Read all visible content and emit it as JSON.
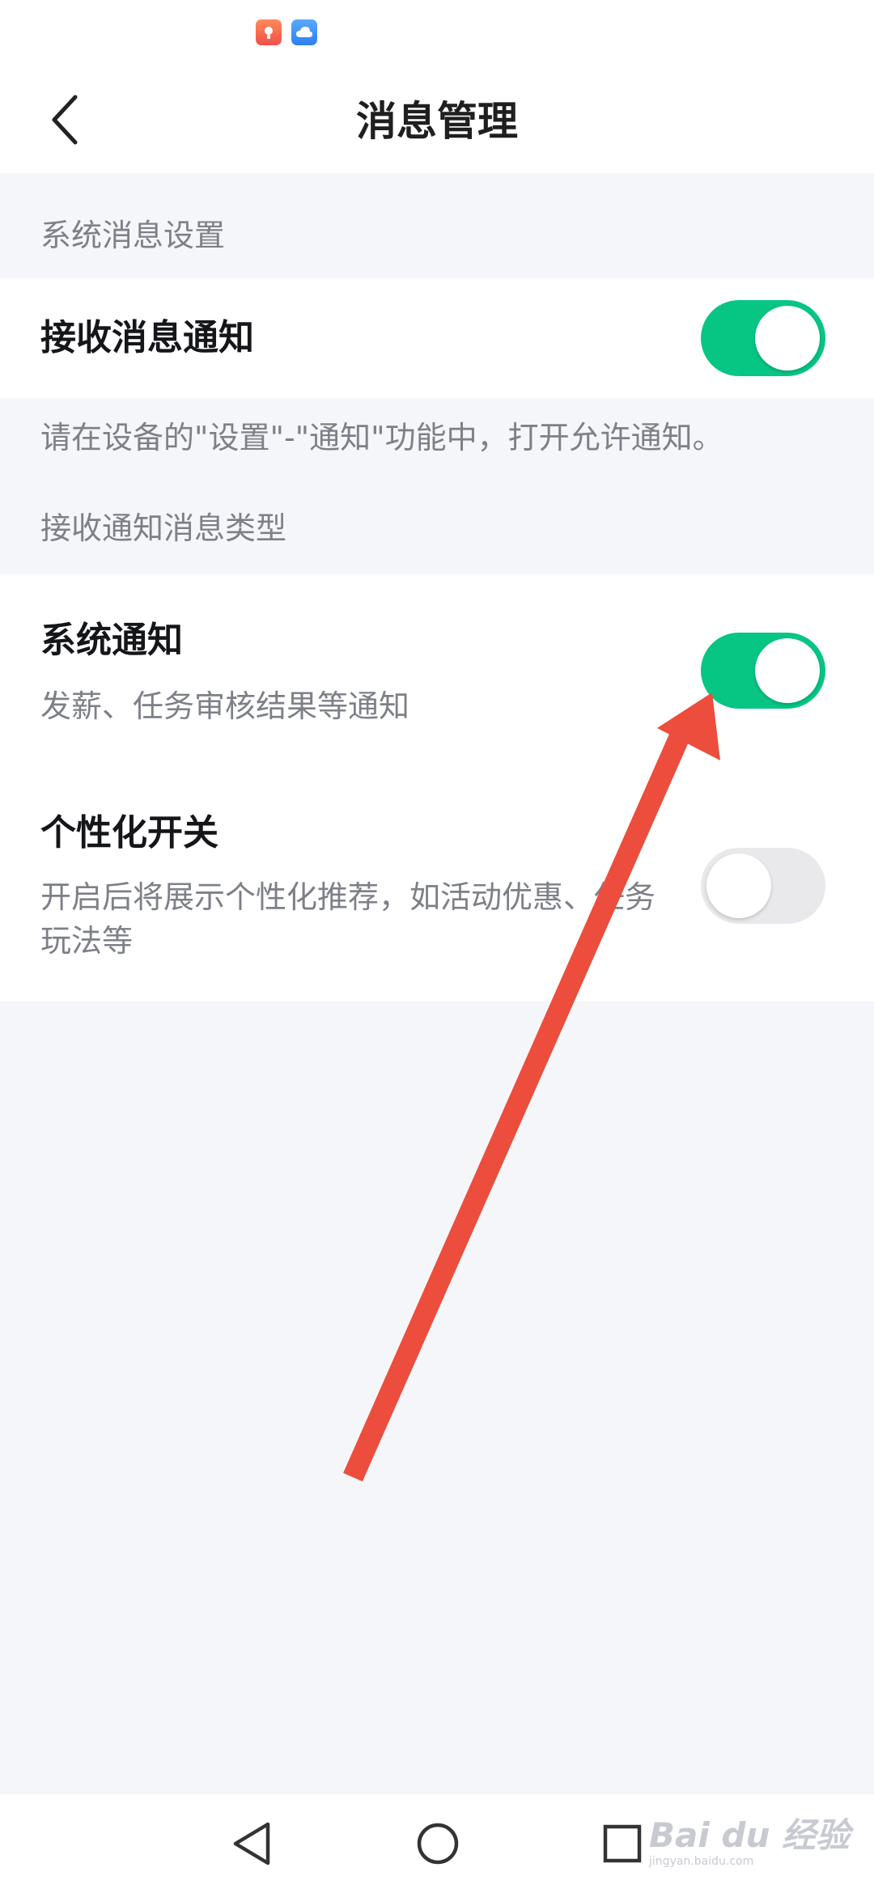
{
  "header": {
    "title": "消息管理"
  },
  "sections": {
    "system_settings_caption": "系统消息设置",
    "receive_notify": {
      "title": "接收消息通知",
      "enabled": true
    },
    "receive_notify_note": "请在设备的\"设置\"-\"通知\"功能中，打开允许通知。",
    "types_caption": "接收通知消息类型",
    "system_notify": {
      "title": "系统通知",
      "subtitle": "发薪、任务审核结果等通知",
      "enabled": true
    },
    "personalized": {
      "title": "个性化开关",
      "subtitle": "开启后将展示个性化推荐，如活动优惠、任务玩法等",
      "enabled": false
    }
  },
  "watermark": {
    "main": "Bai du 经验",
    "sub": "jingyan.baidu.com"
  },
  "colors": {
    "accent_green": "#07c583",
    "toggle_off": "#e9e9ec",
    "arrow_red": "#ec4d3c",
    "background": "#f5f6fa"
  },
  "icons": {
    "back": "chevron-left-icon",
    "nav_back": "triangle-back-icon",
    "nav_home": "circle-home-icon",
    "nav_recent": "square-recent-icon"
  }
}
